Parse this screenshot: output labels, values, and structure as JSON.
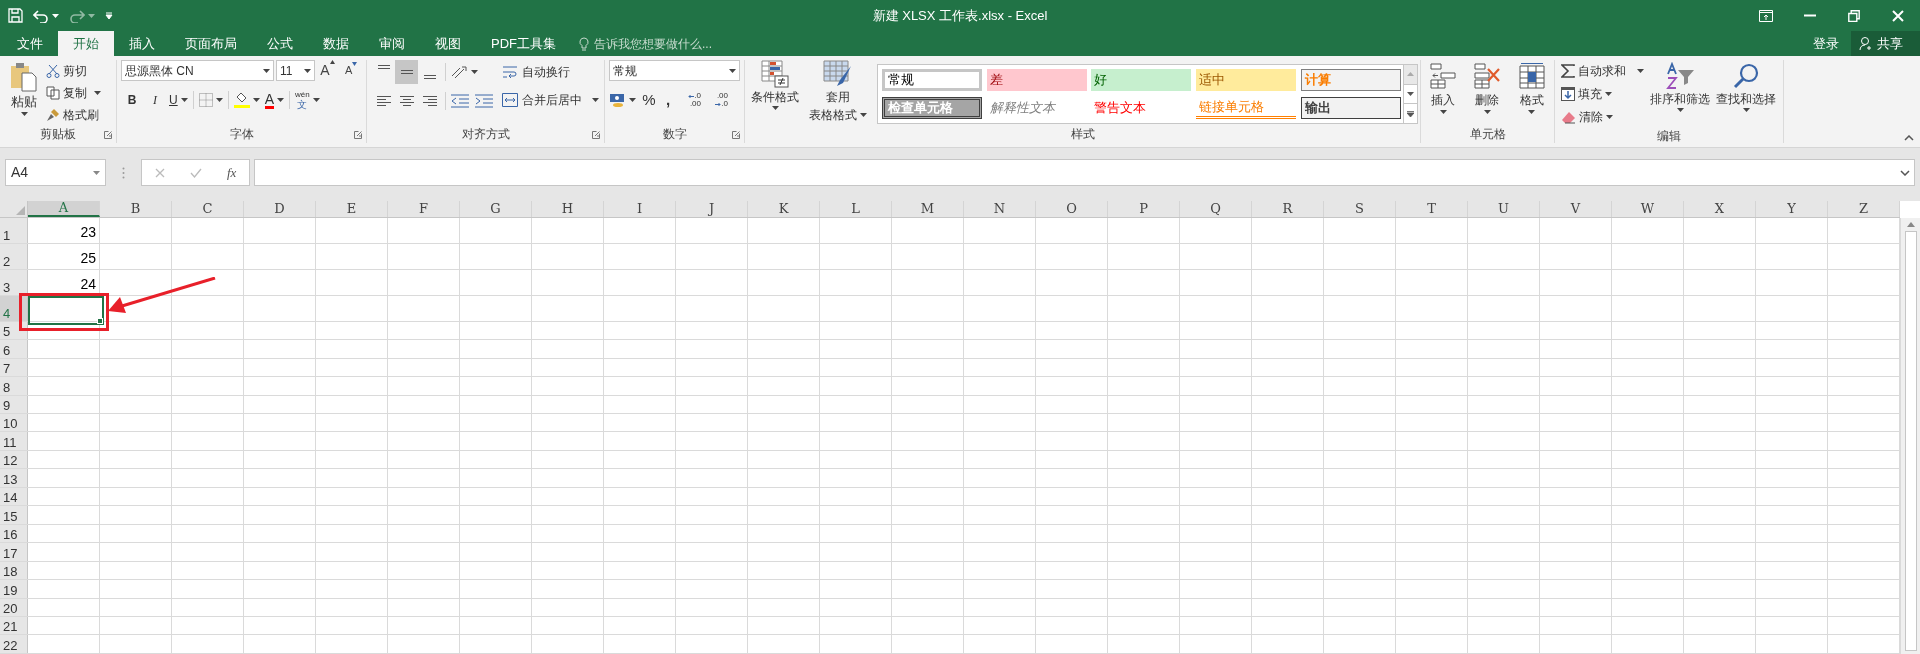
{
  "title_bar": {
    "title": "新建 XLSX 工作表.xlsx - Excel"
  },
  "tabs": [
    {
      "label": "文件",
      "selected": false
    },
    {
      "label": "开始",
      "selected": true
    },
    {
      "label": "插入",
      "selected": false
    },
    {
      "label": "页面布局",
      "selected": false
    },
    {
      "label": "公式",
      "selected": false
    },
    {
      "label": "数据",
      "selected": false
    },
    {
      "label": "审阅",
      "selected": false
    },
    {
      "label": "视图",
      "selected": false
    },
    {
      "label": "PDF工具集",
      "selected": false
    }
  ],
  "tell_me": {
    "placeholder": "告诉我您想要做什么..."
  },
  "account": {
    "sign_in": "登录",
    "share": "共享"
  },
  "ribbon": {
    "clipboard": {
      "label": "剪贴板",
      "paste": "粘贴",
      "cut": "剪切",
      "copy": "复制",
      "format_painter": "格式刷"
    },
    "font": {
      "label": "字体",
      "font_name": "思源黑体 CN",
      "font_size": "11",
      "grow": "A",
      "shrink": "A",
      "bold": "B",
      "italic": "I",
      "underline": "U",
      "font_color": "A",
      "phonetic_top": "wén",
      "phonetic_bottom": "文"
    },
    "alignment": {
      "label": "对齐方式",
      "vertical": [
        {
          "kind": "top",
          "selected": false
        },
        {
          "kind": "middle",
          "selected": true
        },
        {
          "kind": "bottom",
          "selected": false
        }
      ],
      "horizontal": [
        {
          "kind": "left",
          "selected": false
        },
        {
          "kind": "center",
          "selected": false
        },
        {
          "kind": "right",
          "selected": false
        }
      ],
      "wrap_text": "自动换行",
      "merge_center": "合并后居中"
    },
    "number": {
      "label": "数字",
      "format": "常规",
      "percent": "%",
      "comma": ",",
      "increase_decimal": [
        ".0",
        ".00"
      ],
      "decrease_decimal": [
        ".00",
        ".0"
      ]
    },
    "styles": {
      "label": "样式",
      "conditional": "条件格式",
      "table_top": "套用",
      "table_bottom": "表格格式",
      "cell_styles": [
        {
          "label": "常规",
          "kind": "normal"
        },
        {
          "label": "差",
          "kind": "bad"
        },
        {
          "label": "好",
          "kind": "good"
        },
        {
          "label": "适中",
          "kind": "neutral"
        },
        {
          "label": "计算",
          "kind": "calc"
        },
        {
          "label": "检查单元格",
          "kind": "check"
        },
        {
          "label": "解释性文本",
          "kind": "explanatory"
        },
        {
          "label": "警告文本",
          "kind": "warning"
        },
        {
          "label": "链接单元格",
          "kind": "link"
        },
        {
          "label": "输出",
          "kind": "output"
        }
      ]
    },
    "cells": {
      "label": "单元格",
      "items": [
        "插入",
        "删除",
        "格式"
      ]
    },
    "editing": {
      "label": "编辑",
      "autosum": "自动求和",
      "fill": "填充",
      "clear": "清除",
      "sort": "排序和筛选",
      "find": "查找和选择"
    }
  },
  "formula_bar": {
    "name_box": "A4",
    "fx": "fx"
  },
  "sheet": {
    "columns": [
      {
        "label": "A",
        "selected": true
      },
      {
        "label": "B",
        "selected": false
      },
      {
        "label": "C",
        "selected": false
      },
      {
        "label": "D",
        "selected": false
      },
      {
        "label": "E",
        "selected": false
      },
      {
        "label": "F",
        "selected": false
      },
      {
        "label": "G",
        "selected": false
      },
      {
        "label": "H",
        "selected": false
      },
      {
        "label": "I",
        "selected": false
      },
      {
        "label": "J",
        "selected": false
      },
      {
        "label": "K",
        "selected": false
      },
      {
        "label": "L",
        "selected": false
      },
      {
        "label": "M",
        "selected": false
      },
      {
        "label": "N",
        "selected": false
      },
      {
        "label": "O",
        "selected": false
      },
      {
        "label": "P",
        "selected": false
      },
      {
        "label": "Q",
        "selected": false
      },
      {
        "label": "R",
        "selected": false
      },
      {
        "label": "S",
        "selected": false
      },
      {
        "label": "T",
        "selected": false
      },
      {
        "label": "U",
        "selected": false
      },
      {
        "label": "V",
        "selected": false
      },
      {
        "label": "W",
        "selected": false
      },
      {
        "label": "X",
        "selected": false
      },
      {
        "label": "Y",
        "selected": false
      },
      {
        "label": "Z",
        "selected": false
      }
    ],
    "rows": [
      {
        "label": "1",
        "selected": false,
        "cells": [
          {
            "text": "23",
            "active": false
          }
        ]
      },
      {
        "label": "2",
        "selected": false,
        "cells": [
          {
            "text": "25",
            "active": false
          }
        ]
      },
      {
        "label": "3",
        "selected": false,
        "cells": [
          {
            "text": "24",
            "active": false
          }
        ]
      },
      {
        "label": "4",
        "selected": true,
        "cells": [
          {
            "active": true
          }
        ]
      },
      {
        "label": "5",
        "selected": false
      },
      {
        "label": "6",
        "selected": false
      },
      {
        "label": "7",
        "selected": false
      },
      {
        "label": "8",
        "selected": false
      },
      {
        "label": "9",
        "selected": false
      },
      {
        "label": "10",
        "selected": false
      },
      {
        "label": "11",
        "selected": false
      },
      {
        "label": "12",
        "selected": false
      },
      {
        "label": "13",
        "selected": false
      },
      {
        "label": "14",
        "selected": false
      },
      {
        "label": "15",
        "selected": false
      },
      {
        "label": "16",
        "selected": false
      },
      {
        "label": "17",
        "selected": false
      },
      {
        "label": "18",
        "selected": false
      },
      {
        "label": "19",
        "selected": false
      },
      {
        "label": "20",
        "selected": false
      },
      {
        "label": "21",
        "selected": false
      },
      {
        "label": "22",
        "selected": false
      }
    ]
  }
}
